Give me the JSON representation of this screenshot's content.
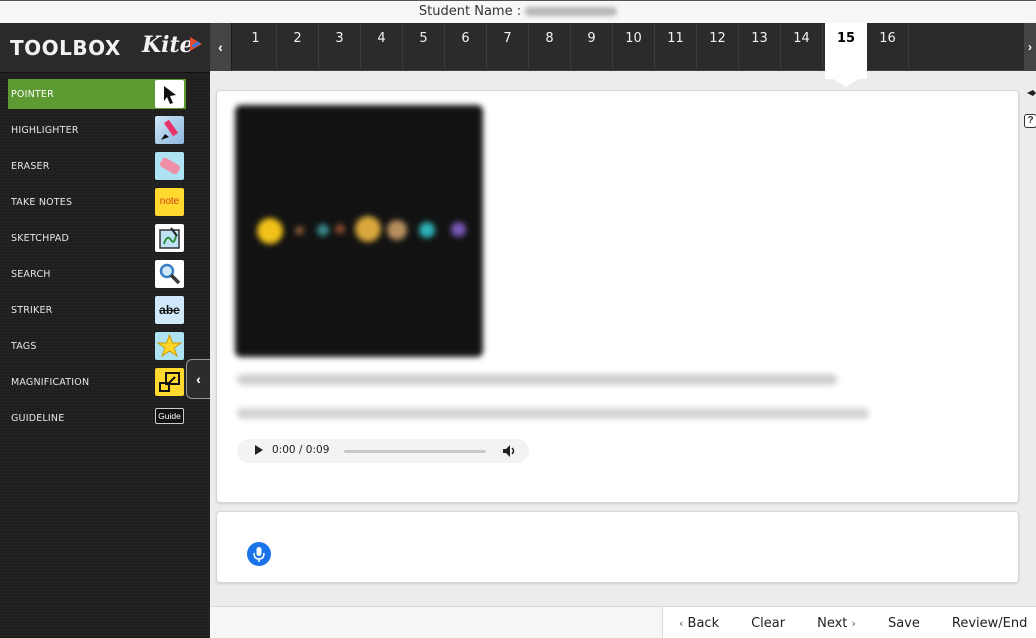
{
  "student_bar": {
    "label": "Student Name :"
  },
  "toolbox": {
    "title": "TOOLBOX",
    "logo": "Kite",
    "tools": [
      {
        "label": "POINTER",
        "icon": "pointer-arrow-icon",
        "active": true
      },
      {
        "label": "HIGHLIGHTER",
        "icon": "highlighter-icon",
        "active": false
      },
      {
        "label": "ERASER",
        "icon": "eraser-icon",
        "active": false
      },
      {
        "label": "TAKE NOTES",
        "icon": "note-icon",
        "icon_text": "note",
        "active": false
      },
      {
        "label": "SKETCHPAD",
        "icon": "sketchpad-icon",
        "active": false
      },
      {
        "label": "SEARCH",
        "icon": "magnifier-icon",
        "active": false
      },
      {
        "label": "STRIKER",
        "icon": "strikethrough-icon",
        "icon_text": "abe",
        "active": false
      },
      {
        "label": "TAGS",
        "icon": "star-icon",
        "active": false
      },
      {
        "label": "MAGNIFICATION",
        "icon": "magnification-icon",
        "active": false
      },
      {
        "label": "GUIDELINE",
        "icon": "guideline-icon",
        "icon_text": "Guide",
        "active": false
      }
    ]
  },
  "question_nav": {
    "questions": [
      "1",
      "2",
      "3",
      "4",
      "5",
      "6",
      "7",
      "8",
      "9",
      "10",
      "11",
      "12",
      "13",
      "14",
      "15",
      "16"
    ],
    "current": "15"
  },
  "question": {
    "audio": {
      "time": "0:00 / 0:09",
      "progress": 0.0
    }
  },
  "footer": {
    "back_label": "Back",
    "clear_label": "Clear",
    "next_label": "Next",
    "save_label": "Save",
    "review_label": "Review/End"
  },
  "colors": {
    "active_tool": "#5d9b32",
    "mic_button": "#1a73e8"
  }
}
